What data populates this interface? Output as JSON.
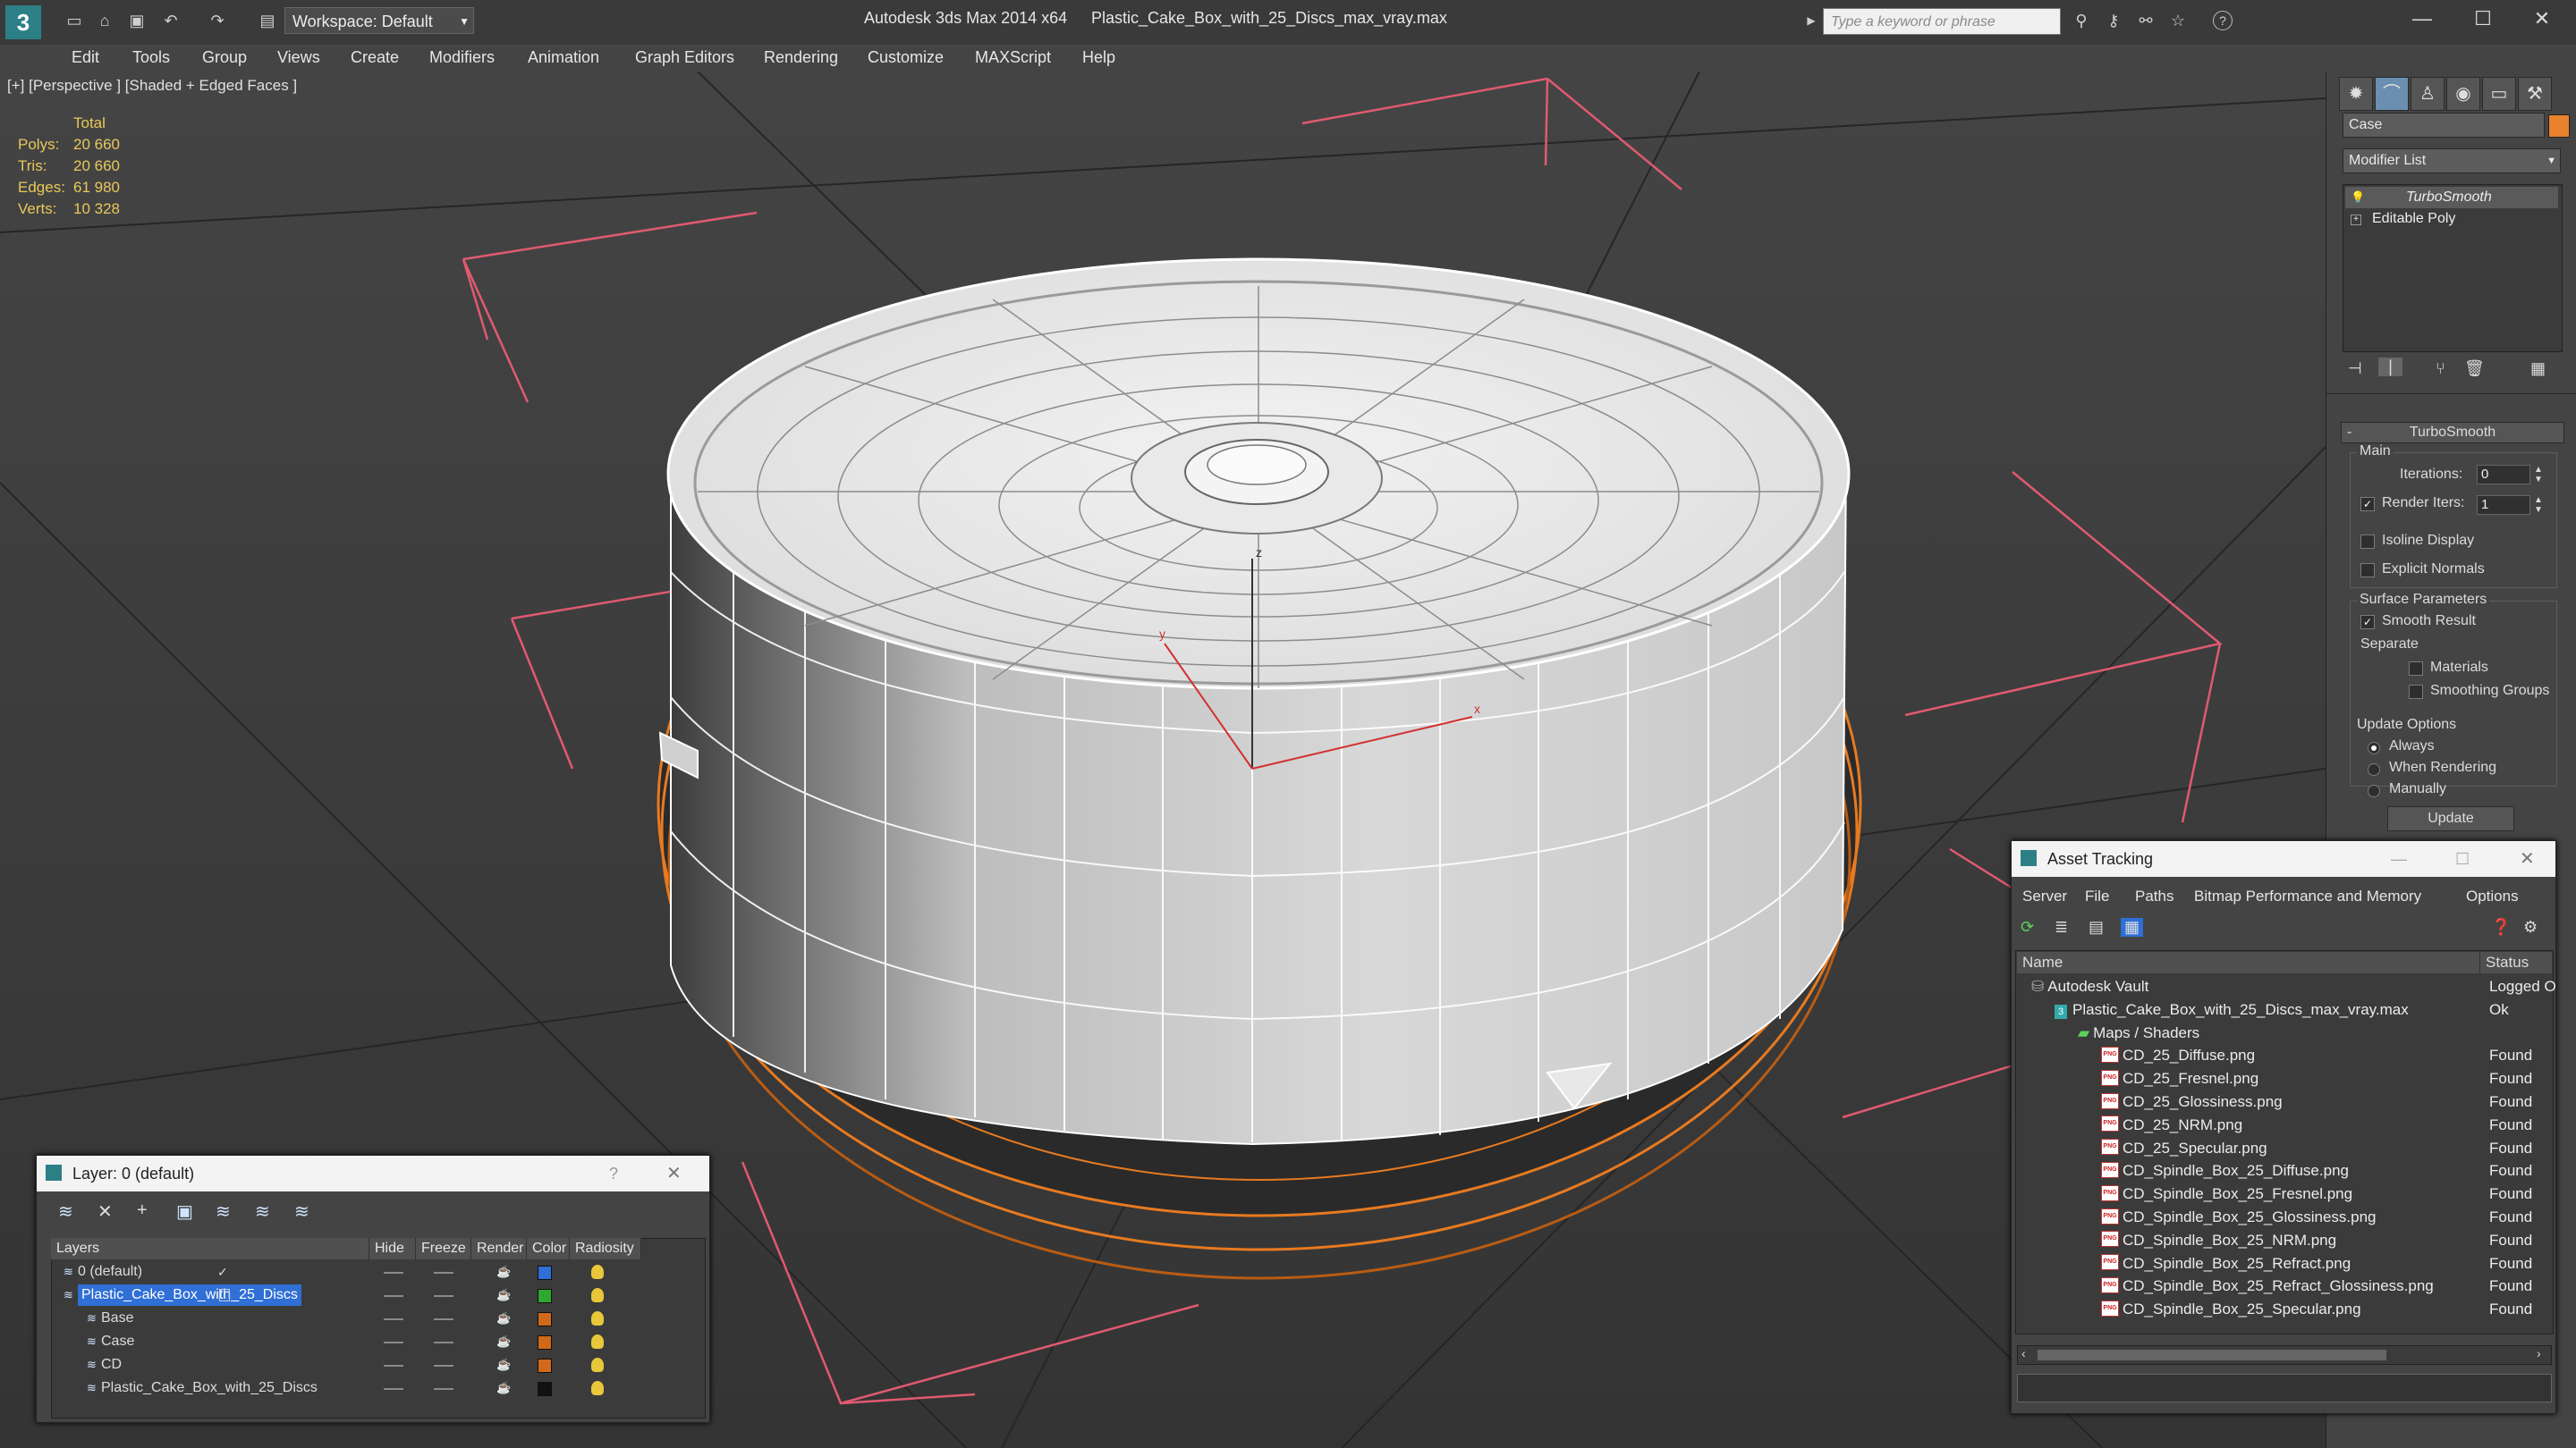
{
  "titlebar": {
    "app": "Autodesk 3ds Max 2014 x64",
    "file": "Plastic_Cake_Box_with_25_Discs_max_vray.max",
    "workspace": "Workspace: Default",
    "search_placeholder": "Type a keyword or phrase"
  },
  "menu": [
    "Edit",
    "Tools",
    "Group",
    "Views",
    "Create",
    "Modifiers",
    "Animation",
    "Graph Editors",
    "Rendering",
    "Customize",
    "MAXScript",
    "Help"
  ],
  "viewport": {
    "label": "[+] [Perspective ] [Shaded + Edged Faces ]",
    "stats_header": "Total",
    "stats": [
      {
        "label": "Polys:",
        "value": "20 660"
      },
      {
        "label": "Tris:",
        "value": "20 660"
      },
      {
        "label": "Edges:",
        "value": "61 980"
      },
      {
        "label": "Verts:",
        "value": "10 328"
      }
    ],
    "axis": {
      "x": "x",
      "y": "y",
      "z": "z"
    }
  },
  "command_panel": {
    "object_name": "Case",
    "object_color": "#e8822c",
    "modifier_list": "Modifier List",
    "stack": [
      "TurboSmooth",
      "Editable Poly"
    ],
    "rollout_title": "TurboSmooth",
    "main_group": "Main",
    "iterations_label": "Iterations:",
    "iterations_value": "0",
    "render_iters_label": "Render Iters:",
    "render_iters_value": "1",
    "isoline": "Isoline Display",
    "explicit_normals": "Explicit Normals",
    "surface_params": "Surface Parameters",
    "smooth_result": "Smooth Result",
    "separate": "Separate",
    "materials": "Materials",
    "smoothing_groups": "Smoothing Groups",
    "update_options": "Update Options",
    "always": "Always",
    "when_rendering": "When Rendering",
    "manually": "Manually",
    "update_button": "Update"
  },
  "layer_window": {
    "title": "Layer: 0 (default)",
    "help": "?",
    "columns": [
      "Layers",
      "Hide",
      "Freeze",
      "Render",
      "Color",
      "Radiosity"
    ],
    "rows": [
      {
        "name": "0 (default)",
        "color": "#2f6fd6",
        "indent": 0,
        "selected": false
      },
      {
        "name": "Plastic_Cake_Box_with_25_Discs",
        "color": "#2fa82f",
        "indent": 0,
        "selected": true
      },
      {
        "name": "Base",
        "color": "#d06a1a",
        "indent": 1,
        "selected": false
      },
      {
        "name": "Case",
        "color": "#d06a1a",
        "indent": 1,
        "selected": false
      },
      {
        "name": "CD",
        "color": "#d06a1a",
        "indent": 1,
        "selected": false
      },
      {
        "name": "Plastic_Cake_Box_with_25_Discs",
        "color": "#111111",
        "indent": 1,
        "selected": false
      }
    ]
  },
  "asset_window": {
    "title": "Asset Tracking",
    "menu": [
      "Server",
      "File",
      "Paths",
      "Bitmap Performance and Memory",
      "Options"
    ],
    "col_name": "Name",
    "col_status": "Status",
    "rows": [
      {
        "name": "Autodesk Vault",
        "status": "Logged O",
        "indent": 0,
        "icon": "vault"
      },
      {
        "name": "Plastic_Cake_Box_with_25_Discs_max_vray.max",
        "status": "Ok",
        "indent": 1,
        "icon": "max"
      },
      {
        "name": "Maps / Shaders",
        "status": "",
        "indent": 2,
        "icon": "maps"
      },
      {
        "name": "CD_25_Diffuse.png",
        "status": "Found",
        "indent": 3,
        "icon": "png"
      },
      {
        "name": "CD_25_Fresnel.png",
        "status": "Found",
        "indent": 3,
        "icon": "png"
      },
      {
        "name": "CD_25_Glossiness.png",
        "status": "Found",
        "indent": 3,
        "icon": "png"
      },
      {
        "name": "CD_25_NRM.png",
        "status": "Found",
        "indent": 3,
        "icon": "png"
      },
      {
        "name": "CD_25_Specular.png",
        "status": "Found",
        "indent": 3,
        "icon": "png"
      },
      {
        "name": "CD_Spindle_Box_25_Diffuse.png",
        "status": "Found",
        "indent": 3,
        "icon": "png"
      },
      {
        "name": "CD_Spindle_Box_25_Fresnel.png",
        "status": "Found",
        "indent": 3,
        "icon": "png"
      },
      {
        "name": "CD_Spindle_Box_25_Glossiness.png",
        "status": "Found",
        "indent": 3,
        "icon": "png"
      },
      {
        "name": "CD_Spindle_Box_25_NRM.png",
        "status": "Found",
        "indent": 3,
        "icon": "png"
      },
      {
        "name": "CD_Spindle_Box_25_Refract.png",
        "status": "Found",
        "indent": 3,
        "icon": "png"
      },
      {
        "name": "CD_Spindle_Box_25_Refract_Glossiness.png",
        "status": "Found",
        "indent": 3,
        "icon": "png"
      },
      {
        "name": "CD_Spindle_Box_25_Specular.png",
        "status": "Found",
        "indent": 3,
        "icon": "png"
      }
    ]
  }
}
